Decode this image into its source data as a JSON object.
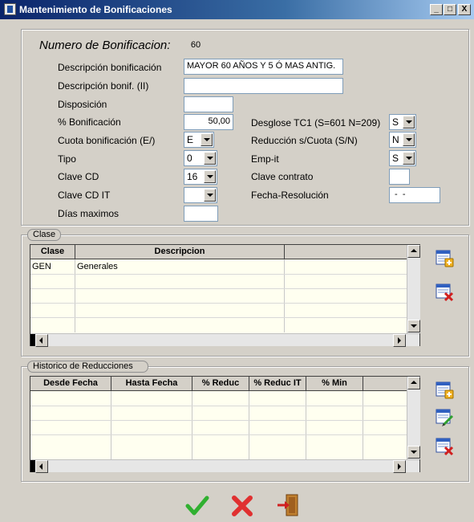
{
  "window": {
    "title": "Mantenimiento de Bonificaciones",
    "min_label": "_",
    "max_label": "□",
    "close_label": "X"
  },
  "form": {
    "numero_label": "Numero de Bonificacion:",
    "numero_value": "60",
    "descripcion_label": "Descripción  bonificación",
    "descripcion_value": "MAYOR 60 AÑOS Y 5 Ó MAS ANTIG.",
    "descripcion2_label": "Descripción bonif. (II)",
    "descripcion2_value": "",
    "disposicion_label": "Disposición",
    "disposicion_value": "",
    "porc_label": "% Bonificación",
    "porc_value": "50,00",
    "cuota_label": "Cuota bonificación (E/)",
    "cuota_value": "E",
    "tipo_label": "Tipo",
    "tipo_value": "0",
    "clavecd_label": "Clave CD",
    "clavecd_value": "16",
    "clavecdit_label": "Clave CD IT",
    "clavecdit_value": "",
    "dias_label": "Días maximos",
    "dias_value": "",
    "desglose_label": "Desglose  TC1 (S=601 N=209)",
    "desglose_value": "S",
    "reduccion_label": "Reducción s/Cuota (S/N)",
    "reduccion_value": "N",
    "empit_label": "Emp-it",
    "empit_value": "S",
    "clavecontrato_label": "Clave contrato",
    "clavecontrato_value": "",
    "fecharesol_label": "Fecha-Resolución",
    "fecharesol_value": " -  -"
  },
  "clase": {
    "legend": "Clase",
    "columns": [
      "Clase",
      "Descripcion",
      ""
    ],
    "rows": [
      {
        "clase": "GEN",
        "descripcion": "Generales"
      }
    ]
  },
  "historico": {
    "legend": "Historico de Reducciones",
    "columns": [
      "Desde Fecha",
      "Hasta Fecha",
      "% Reduc",
      "% Reduc IT",
      "% Min",
      ""
    ]
  },
  "icons": {
    "clase_add": "add-record-icon",
    "clase_delete": "delete-record-icon",
    "hist_add": "add-record-icon",
    "hist_edit": "edit-record-icon",
    "hist_delete": "delete-record-icon",
    "accept": "green-check-icon",
    "cancel": "red-x-icon",
    "exit": "exit-door-icon"
  },
  "colors": {
    "title_gradient_start": "#0a246a",
    "grid_background": "#fffff0",
    "window_background": "#d4d0c8"
  }
}
